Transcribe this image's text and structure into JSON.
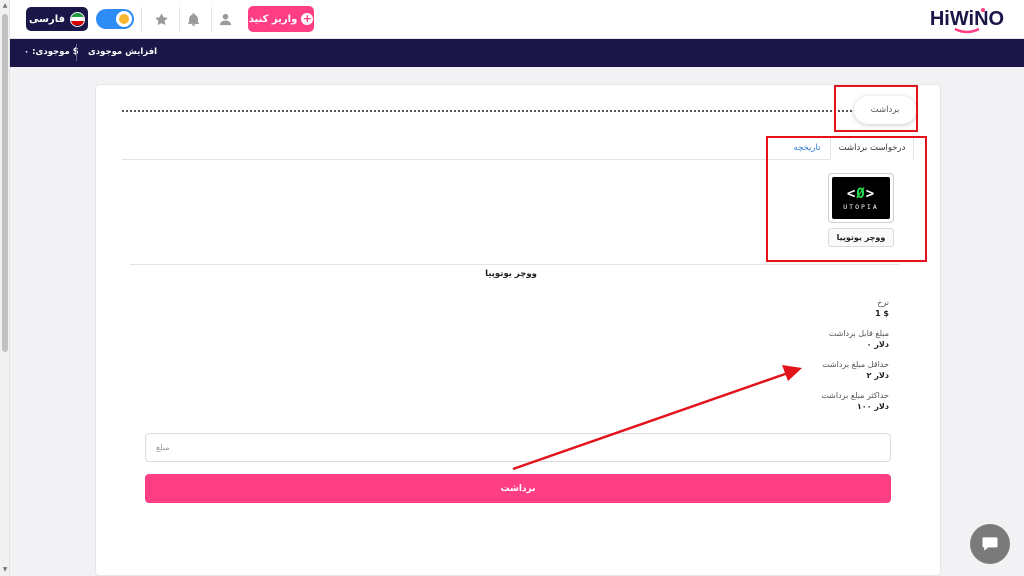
{
  "header": {
    "language_label": "فارسی",
    "deposit_label": "واریز کنید",
    "logo_text": "HiWiNO",
    "colors": {
      "navy": "#1b1648",
      "pink": "#ff3e84",
      "toggle_blue": "#2e8df5"
    }
  },
  "subheader": {
    "balance_label": "موجودی: ۰ $",
    "increase_label": "افزایش موجودی"
  },
  "page": {
    "title": "برداشت",
    "tabs": [
      {
        "label": "درخواست برداشت",
        "active": true
      },
      {
        "label": "تاریخچه",
        "active": false
      }
    ],
    "voucher": {
      "logo_glyph_left": "<",
      "logo_glyph_mid": "Ø",
      "logo_glyph_right": ">",
      "logo_sub": "UTOPIA",
      "label": "ووچر یوتوپیا"
    },
    "selected_title": "ووچر یوتوپیا",
    "info": [
      {
        "key": "نرخ",
        "value": "1 $"
      },
      {
        "key": "مبلغ قابل برداشت",
        "value": "۰ دلار"
      },
      {
        "key": "حداقل مبلغ برداشت",
        "value": "۲ دلار"
      },
      {
        "key": "حداکثر مبلغ برداشت",
        "value": "۱۰۰ دلار"
      }
    ],
    "amount_placeholder": "مبلغ",
    "submit_label": "برداشت"
  },
  "annotation_color": "#e3131b",
  "icons": [
    "flag-iran-icon",
    "sun-icon",
    "star-icon",
    "bell-icon",
    "user-icon",
    "plus-circle-icon",
    "chat-icon"
  ]
}
